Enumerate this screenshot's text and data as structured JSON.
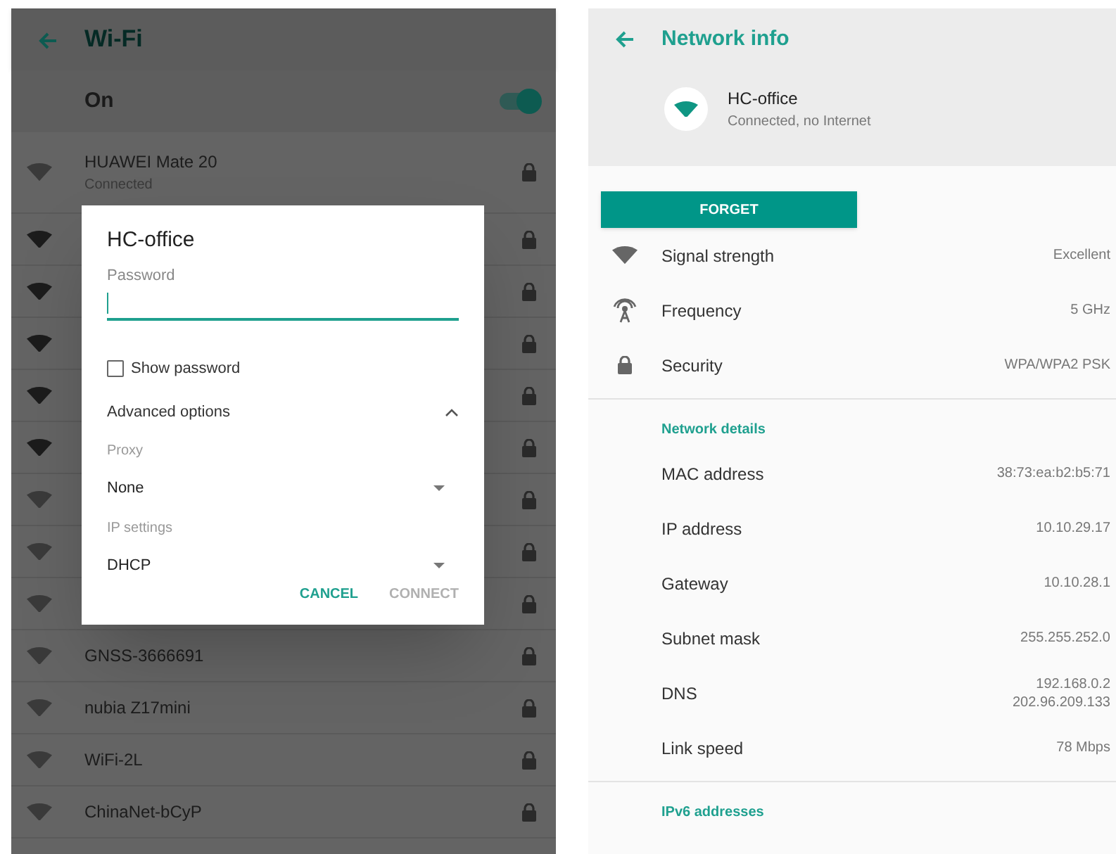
{
  "wifi_screen": {
    "title": "Wi-Fi",
    "master_switch": {
      "label": "On",
      "on": true
    },
    "networks": [
      {
        "name": "HUAWEI Mate 20",
        "status": "Connected",
        "strong": false,
        "locked": true
      },
      {
        "strong": true,
        "locked": true
      },
      {
        "strong": true,
        "locked": true
      },
      {
        "strong": true,
        "locked": true
      },
      {
        "strong": true,
        "locked": true
      },
      {
        "strong": true,
        "locked": true
      },
      {
        "strong": false,
        "locked": true
      },
      {
        "strong": false,
        "locked": true
      },
      {
        "strong": false,
        "locked": true
      },
      {
        "name": "GNSS-3666691",
        "strong": false,
        "locked": true
      },
      {
        "name": "nubia Z17mini",
        "strong": false,
        "locked": true
      },
      {
        "name": "WiFi-2L",
        "strong": false,
        "locked": true
      },
      {
        "name": "ChinaNet-bCyP",
        "strong": false,
        "locked": true
      }
    ]
  },
  "dialog": {
    "title": "HC-office",
    "password": {
      "label": "Password"
    },
    "show_password": {
      "label": "Show password",
      "checked": false
    },
    "advanced": {
      "label": "Advanced options",
      "expanded": true
    },
    "proxy": {
      "label": "Proxy",
      "value": "None"
    },
    "ip_settings": {
      "label": "IP settings",
      "value": "DHCP"
    },
    "buttons": [
      {
        "label": "CANCEL",
        "disabled": false
      },
      {
        "label": "CONNECT",
        "disabled": true
      }
    ]
  },
  "network_info": {
    "title": "Network info",
    "network": {
      "name": "HC-office",
      "status": "Connected, no Internet"
    },
    "forget_button": "FORGET",
    "properties": [
      {
        "kind": "signal",
        "label": "Signal strength",
        "value": "Excellent"
      },
      {
        "kind": "frequency",
        "label": "Frequency",
        "value": "5 GHz"
      },
      {
        "kind": "security",
        "label": "Security",
        "value": "WPA/WPA2 PSK"
      }
    ],
    "sections": [
      {
        "title": "Network details",
        "rows": [
          {
            "label": "MAC address",
            "values": [
              "38:73:ea:b2:b5:71"
            ]
          },
          {
            "label": "IP address",
            "values": [
              "10.10.29.17"
            ]
          },
          {
            "label": "Gateway",
            "values": [
              "10.10.28.1"
            ]
          },
          {
            "label": "Subnet mask",
            "values": [
              "255.255.252.0"
            ]
          },
          {
            "label": "DNS",
            "values": [
              "192.168.0.2",
              "202.96.209.133"
            ]
          },
          {
            "label": "Link speed",
            "values": [
              "78 Mbps"
            ]
          }
        ]
      },
      {
        "title": "IPv6 addresses"
      }
    ]
  }
}
